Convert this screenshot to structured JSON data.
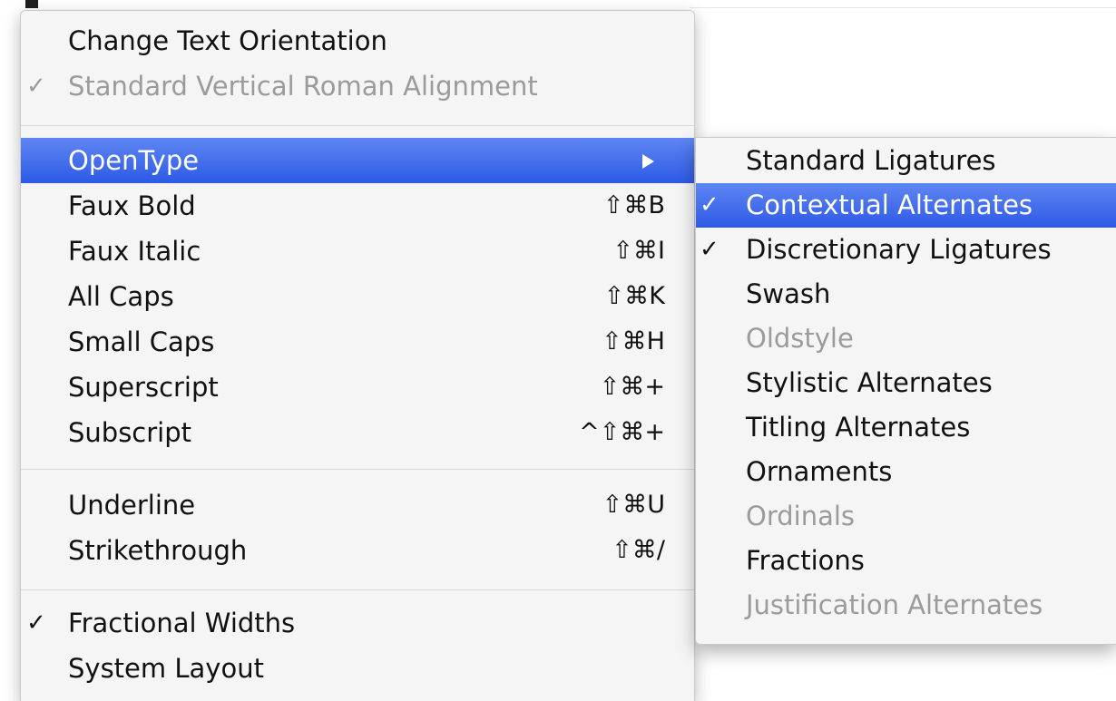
{
  "main_menu": {
    "orientation": {
      "change_text_orientation": {
        "label": "Change Text Orientation",
        "checked": false,
        "enabled": true
      },
      "standard_vertical_roman_alignment": {
        "label": "Standard Vertical Roman Alignment",
        "checked": true,
        "enabled": false,
        "check": "✓"
      }
    },
    "style_items": [
      {
        "label": "OpenType",
        "shortcut": "",
        "submenu": true,
        "highlighted": true
      },
      {
        "label": "Faux Bold",
        "shortcut": "⇧⌘B"
      },
      {
        "label": "Faux Italic",
        "shortcut": "⇧⌘I"
      },
      {
        "label": "All Caps",
        "shortcut": "⇧⌘K"
      },
      {
        "label": "Small Caps",
        "shortcut": "⇧⌘H"
      },
      {
        "label": "Superscript",
        "shortcut": "⇧⌘+"
      },
      {
        "label": "Subscript",
        "shortcut": "^⇧⌘+"
      }
    ],
    "line_items": [
      {
        "label": "Underline",
        "shortcut": "⇧⌘U"
      },
      {
        "label": "Strikethrough",
        "shortcut": "⇧⌘/"
      }
    ],
    "layout_items": [
      {
        "label": "Fractional Widths",
        "checked": true,
        "check": "✓"
      },
      {
        "label": "System Layout",
        "checked": false
      }
    ]
  },
  "opentype_submenu": {
    "items": [
      {
        "label": "Standard Ligatures",
        "checked": false,
        "enabled": true,
        "highlighted": false
      },
      {
        "label": "Contextual Alternates",
        "checked": true,
        "enabled": true,
        "highlighted": true,
        "check": "✓"
      },
      {
        "label": "Discretionary Ligatures",
        "checked": true,
        "enabled": true,
        "highlighted": false,
        "check": "✓"
      },
      {
        "label": "Swash",
        "checked": false,
        "enabled": true,
        "highlighted": false
      },
      {
        "label": "Oldstyle",
        "checked": false,
        "enabled": false,
        "highlighted": false
      },
      {
        "label": "Stylistic Alternates",
        "checked": false,
        "enabled": true,
        "highlighted": false
      },
      {
        "label": "Titling Alternates",
        "checked": false,
        "enabled": true,
        "highlighted": false
      },
      {
        "label": "Ornaments",
        "checked": false,
        "enabled": true,
        "highlighted": false
      },
      {
        "label": "Ordinals",
        "checked": false,
        "enabled": false,
        "highlighted": false
      },
      {
        "label": "Fractions",
        "checked": false,
        "enabled": true,
        "highlighted": false
      },
      {
        "label": "Justification Alternates",
        "checked": false,
        "enabled": false,
        "highlighted": false
      }
    ]
  },
  "colors": {
    "menu_background": "#f5f5f5",
    "highlight_top": "#5f86f2",
    "highlight_bottom": "#2d5ae6",
    "disabled_text": "#9b9b9b",
    "text": "#111111"
  }
}
